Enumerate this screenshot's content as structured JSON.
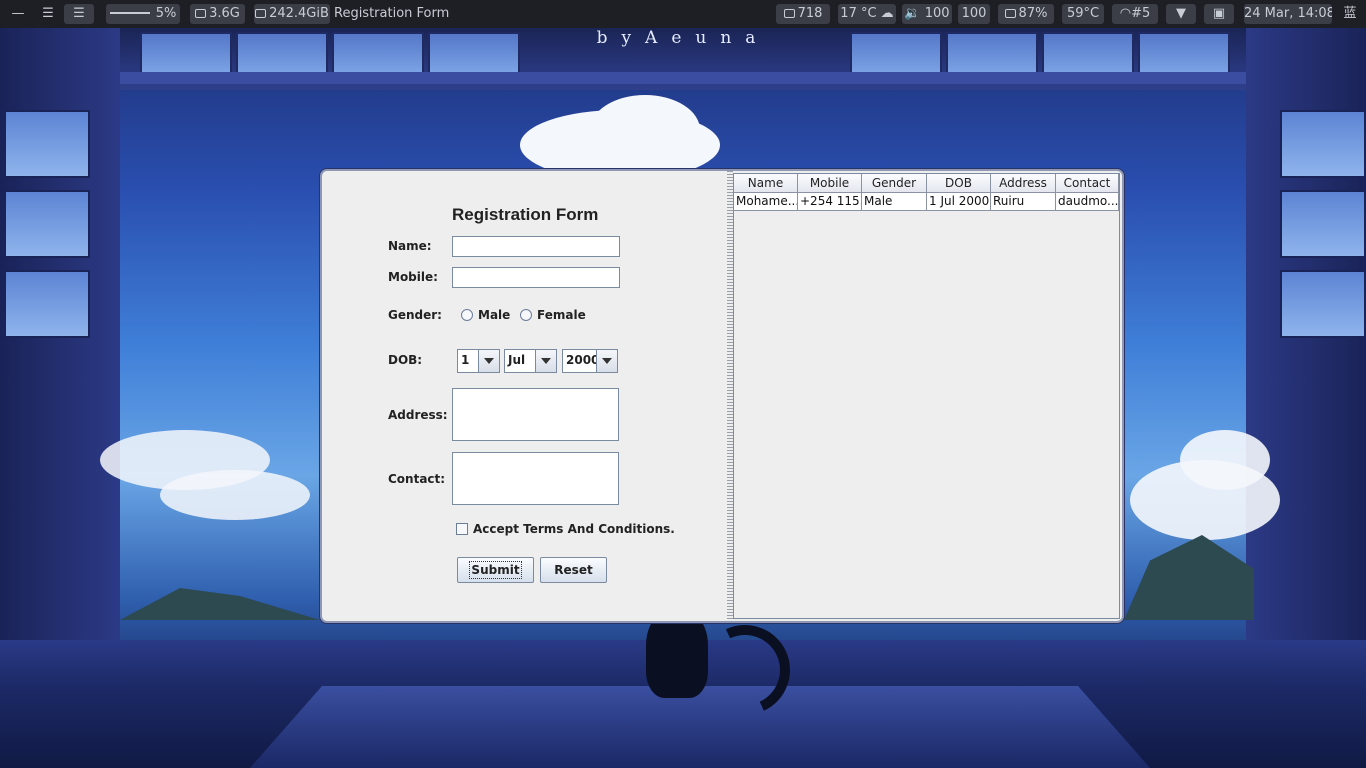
{
  "topbar": {
    "cpu": "5%",
    "memory": "3.6G",
    "disk": "242.4GiB",
    "window_title": "Registration Form",
    "updates": "718",
    "weather": "17 °C ☁",
    "volume": "100",
    "brightness": "100",
    "battery": "87%",
    "temperature": "59°C",
    "wifi": "#5",
    "datetime": "24 Mar, 14:08",
    "layout": "蓝"
  },
  "wallpaper": {
    "watermark": "byAeuna"
  },
  "form": {
    "title": "Registration Form",
    "name_label": "Name:",
    "name_value": "",
    "mobile_label": "Mobile:",
    "mobile_value": "",
    "gender_label": "Gender:",
    "gender_options": [
      "Male",
      "Female"
    ],
    "dob_label": "DOB:",
    "dob_day": "1",
    "dob_month": "Jul",
    "dob_year": "2000",
    "address_label": "Address:",
    "address_value": "",
    "contact_label": "Contact:",
    "contact_value": "",
    "terms_label": "Accept Terms And Conditions.",
    "submit_label": "Submit",
    "reset_label": "Reset"
  },
  "table": {
    "columns": [
      "Name",
      "Mobile",
      "Gender",
      "DOB",
      "Address",
      "Contact"
    ],
    "rows": [
      [
        "Mohame...",
        "+254 115...",
        "Male",
        "1 Jul 2000",
        "Ruiru",
        "daudmo..."
      ]
    ]
  },
  "colors": {
    "window_bg": "#eeeeee",
    "topbar_bg": "#1d1f24",
    "widget_bg": "#3b3e46"
  }
}
